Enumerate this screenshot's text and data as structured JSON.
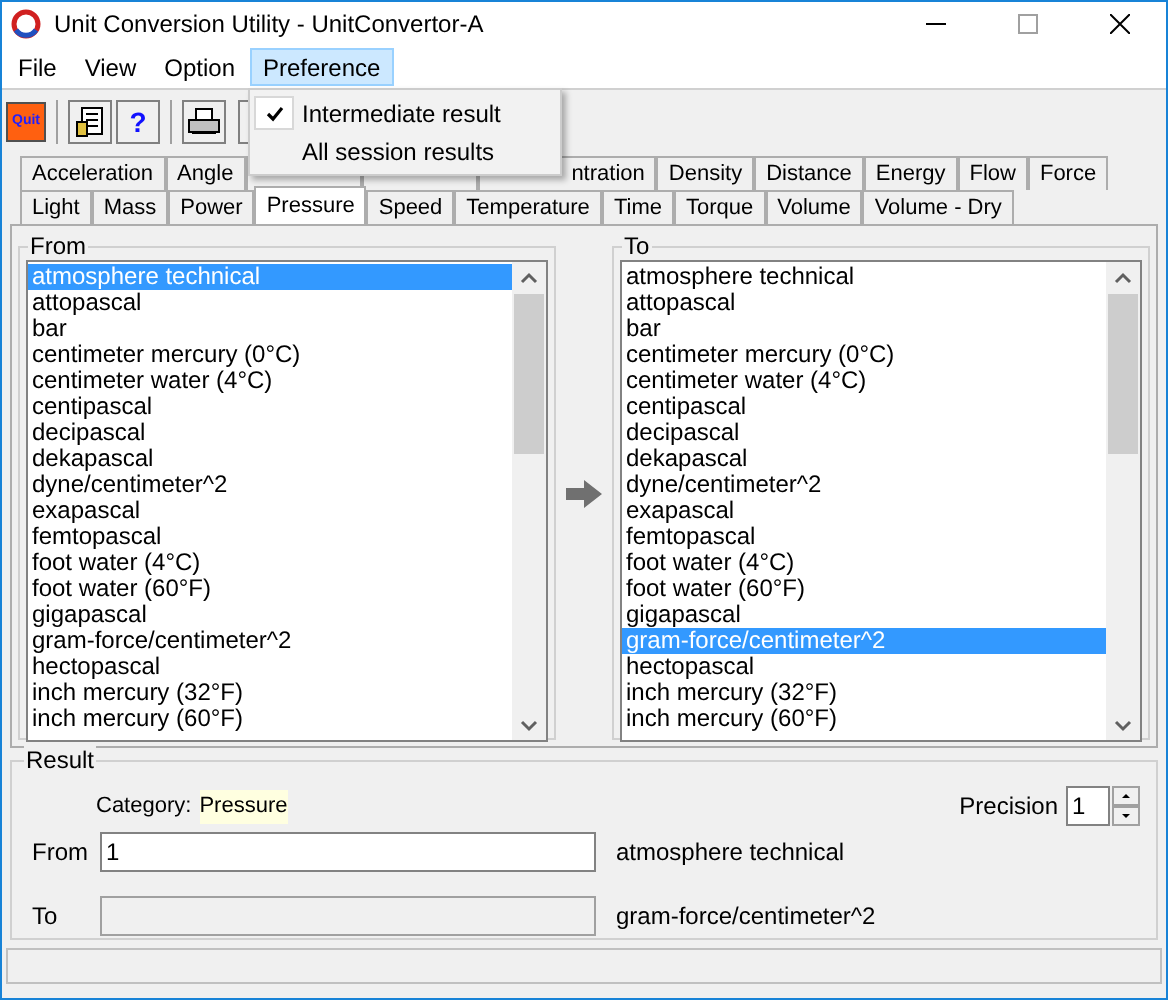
{
  "window": {
    "title": "Unit Conversion Utility - UnitConvertor-A"
  },
  "menu": [
    {
      "label": "File",
      "selected": false
    },
    {
      "label": "View",
      "selected": false
    },
    {
      "label": "Option",
      "selected": false
    },
    {
      "label": "Preference",
      "selected": true
    }
  ],
  "dropdown": [
    {
      "label": "Intermediate result",
      "checked": true
    },
    {
      "label": "All session results",
      "checked": false
    }
  ],
  "toolbar": {
    "quit_label": "Quit",
    "help_label": "?"
  },
  "tabs_row_1": [
    {
      "label": "Acceleration",
      "selected": false
    },
    {
      "label": "Angle",
      "selected": false
    },
    {
      "kind": "covered",
      "selected": false
    },
    {
      "kind": "covered",
      "selected": false
    },
    {
      "kind": "partial",
      "label": "ntration",
      "selected": false
    },
    {
      "label": "Density",
      "selected": false
    },
    {
      "label": "Distance",
      "selected": false
    },
    {
      "label": "Energy",
      "selected": false
    },
    {
      "label": "Flow",
      "selected": false
    },
    {
      "label": "Force",
      "selected": false
    }
  ],
  "tabs_row_2": [
    {
      "label": "Light",
      "selected": false
    },
    {
      "label": "Mass",
      "selected": false
    },
    {
      "label": "Power",
      "selected": false
    },
    {
      "label": "Pressure",
      "selected": true
    },
    {
      "label": "Speed",
      "selected": false
    },
    {
      "label": "Temperature",
      "selected": false
    },
    {
      "label": "Time",
      "selected": false
    },
    {
      "label": "Torque",
      "selected": false
    },
    {
      "label": "Volume",
      "selected": false
    },
    {
      "label": "Volume - Dry",
      "selected": false
    }
  ],
  "from_list": {
    "title": "From",
    "items": [
      {
        "label": "atmosphere technical",
        "selected": true
      },
      {
        "label": "attopascal",
        "selected": false
      },
      {
        "label": "bar",
        "selected": false
      },
      {
        "label": "centimeter mercury (0°C)",
        "selected": false
      },
      {
        "label": "centimeter water (4°C)",
        "selected": false
      },
      {
        "label": "centipascal",
        "selected": false
      },
      {
        "label": "decipascal",
        "selected": false
      },
      {
        "label": "dekapascal",
        "selected": false
      },
      {
        "label": "dyne/centimeter^2",
        "selected": false
      },
      {
        "label": "exapascal",
        "selected": false
      },
      {
        "label": "femtopascal",
        "selected": false
      },
      {
        "label": "foot water (4°C)",
        "selected": false
      },
      {
        "label": "foot water (60°F)",
        "selected": false
      },
      {
        "label": "gigapascal",
        "selected": false
      },
      {
        "label": "gram-force/centimeter^2",
        "selected": false
      },
      {
        "label": "hectopascal",
        "selected": false
      },
      {
        "label": "inch mercury (32°F)",
        "selected": false
      },
      {
        "label": "inch mercury (60°F)",
        "selected": false
      }
    ]
  },
  "to_list": {
    "title": "To",
    "items": [
      {
        "label": "atmosphere technical",
        "selected": false
      },
      {
        "label": "attopascal",
        "selected": false
      },
      {
        "label": "bar",
        "selected": false
      },
      {
        "label": "centimeter mercury (0°C)",
        "selected": false
      },
      {
        "label": "centimeter water (4°C)",
        "selected": false
      },
      {
        "label": "centipascal",
        "selected": false
      },
      {
        "label": "decipascal",
        "selected": false
      },
      {
        "label": "dekapascal",
        "selected": false
      },
      {
        "label": "dyne/centimeter^2",
        "selected": false
      },
      {
        "label": "exapascal",
        "selected": false
      },
      {
        "label": "femtopascal",
        "selected": false
      },
      {
        "label": "foot water (4°C)",
        "selected": false
      },
      {
        "label": "foot water (60°F)",
        "selected": false
      },
      {
        "label": "gigapascal",
        "selected": false
      },
      {
        "label": "gram-force/centimeter^2",
        "selected": true
      },
      {
        "label": "hectopascal",
        "selected": false
      },
      {
        "label": "inch mercury (32°F)",
        "selected": false
      },
      {
        "label": "inch mercury (60°F)",
        "selected": false
      }
    ]
  },
  "result": {
    "title": "Result",
    "category_label": "Category:",
    "category": "Pressure",
    "precision_label": "Precision",
    "precision": "1",
    "from_label": "From",
    "from_value": "1",
    "from_unit": "atmosphere technical",
    "to_label": "To",
    "to_unit": "gram-force/centimeter^2"
  }
}
